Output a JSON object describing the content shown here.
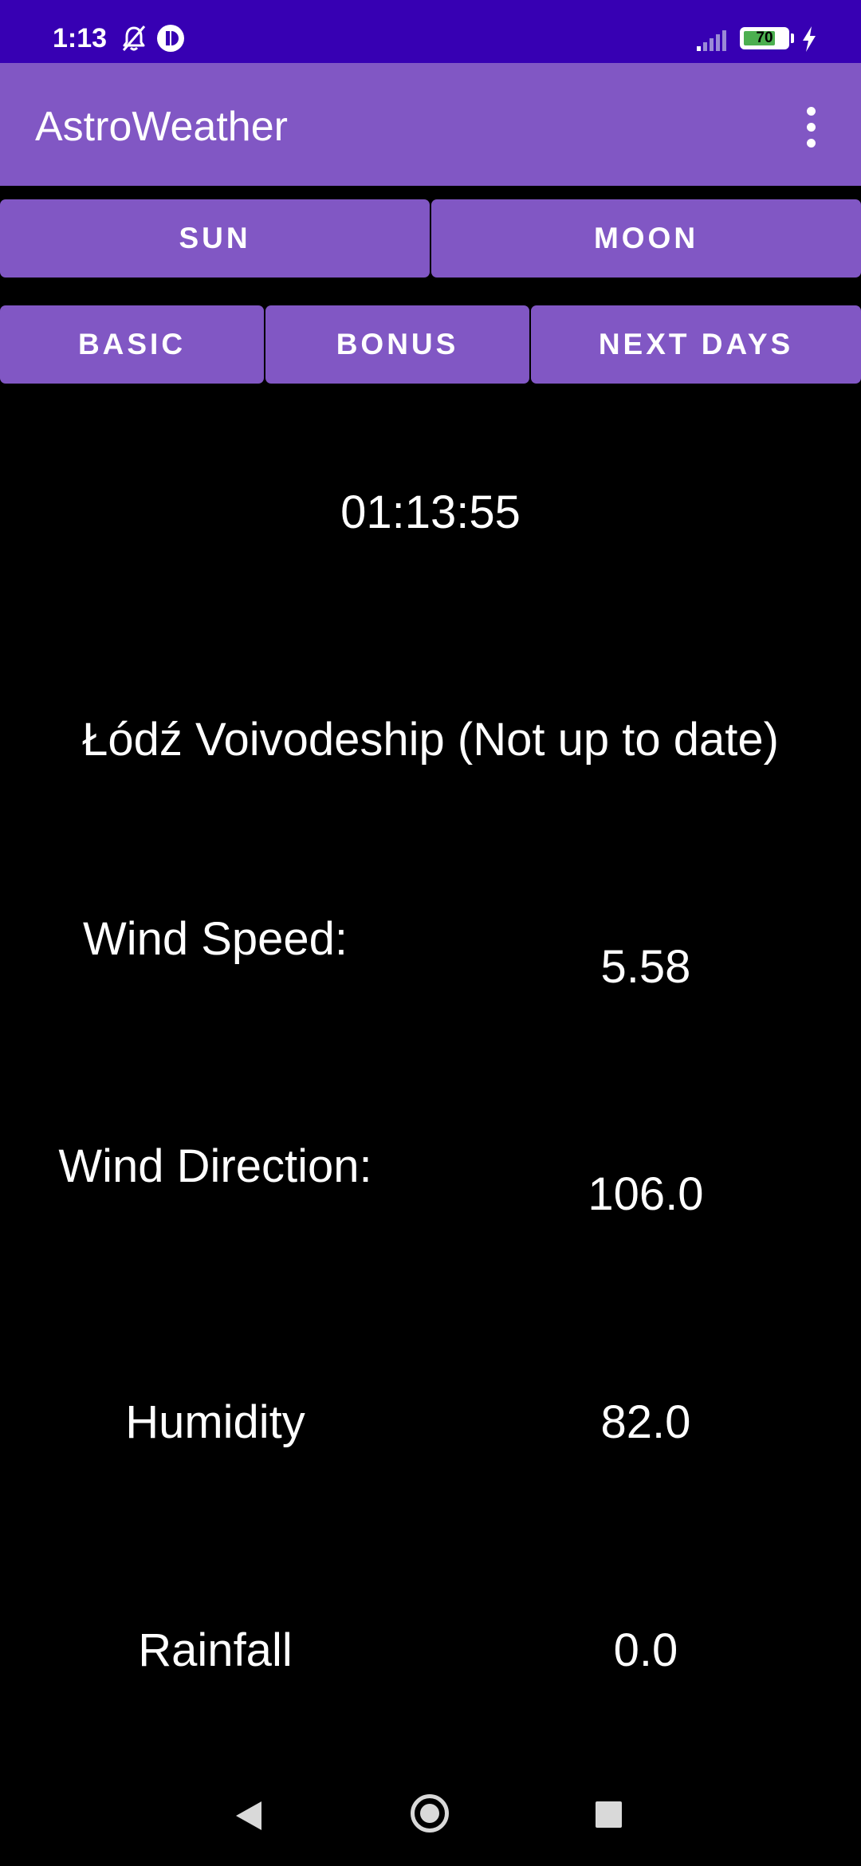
{
  "status_bar": {
    "time": "1:13",
    "battery_level": "70",
    "icons": [
      "bell-off-icon",
      "app-notification-icon",
      "signal-icon",
      "battery-icon",
      "charging-icon"
    ],
    "color": "#3700B3"
  },
  "app_bar": {
    "title": "AstroWeather",
    "menu_icon": "more-vert-icon",
    "color": "#8157C4"
  },
  "top_tabs": {
    "sun_label": "SUN",
    "moon_label": "MOON"
  },
  "sub_tabs": {
    "basic_label": "BASIC",
    "bonus_label": "BONUS",
    "next_days_label": "NEXT DAYS"
  },
  "main": {
    "clock": "01:13:55",
    "location": "Łódź Voivodeship (Not up to date)",
    "rows": [
      {
        "label": "Wind Speed:",
        "value": "5.58"
      },
      {
        "label": "Wind Direction:",
        "value": "106.0"
      },
      {
        "label": "Humidity",
        "value": "82.0"
      },
      {
        "label": "Rainfall",
        "value": "0.0"
      }
    ]
  },
  "nav_bar": {
    "icons": [
      "back-icon",
      "home-icon",
      "recents-icon"
    ]
  }
}
